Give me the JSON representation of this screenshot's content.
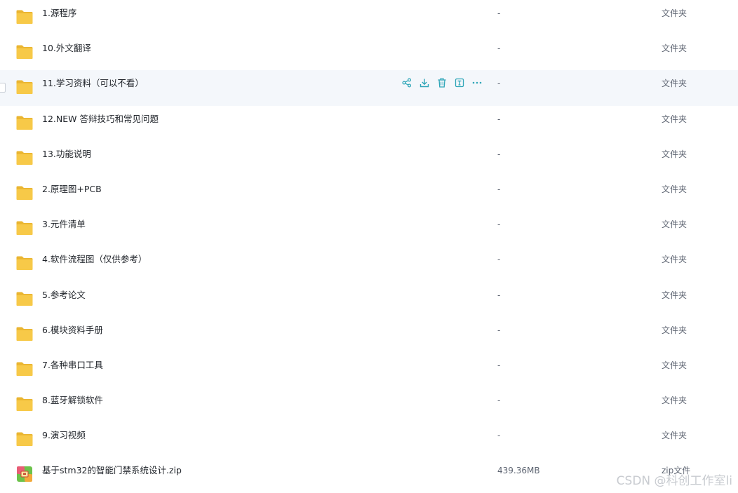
{
  "rows": [
    {
      "name": "1.源程序",
      "size": "-",
      "type": "文件夹",
      "icon": "folder-icon"
    },
    {
      "name": "10.外文翻译",
      "size": "-",
      "type": "文件夹",
      "icon": "folder-icon"
    },
    {
      "name": "11.学习资料（可以不看）",
      "size": "-",
      "type": "文件夹",
      "icon": "folder-icon"
    },
    {
      "name": "12.NEW 答辩技巧和常见问题",
      "size": "-",
      "type": "文件夹",
      "icon": "folder-icon"
    },
    {
      "name": "13.功能说明",
      "size": "-",
      "type": "文件夹",
      "icon": "folder-icon"
    },
    {
      "name": "2.原理图+PCB",
      "size": "-",
      "type": "文件夹",
      "icon": "folder-icon"
    },
    {
      "name": "3.元件清单",
      "size": "-",
      "type": "文件夹",
      "icon": "folder-icon"
    },
    {
      "name": "4.软件流程图（仅供参考）",
      "size": "-",
      "type": "文件夹",
      "icon": "folder-icon"
    },
    {
      "name": "5.参考论文",
      "size": "-",
      "type": "文件夹",
      "icon": "folder-icon"
    },
    {
      "name": "6.模块资料手册",
      "size": "-",
      "type": "文件夹",
      "icon": "folder-icon"
    },
    {
      "name": "7.各种串口工具",
      "size": "-",
      "type": "文件夹",
      "icon": "folder-icon"
    },
    {
      "name": "8.蓝牙解锁软件",
      "size": "-",
      "type": "文件夹",
      "icon": "folder-icon"
    },
    {
      "name": "9.演习视频",
      "size": "-",
      "type": "文件夹",
      "icon": "folder-icon"
    },
    {
      "name": "基于stm32的智能门禁系统设计.zip",
      "size": "439.36MB",
      "type": "zip文件",
      "icon": "zip-archive-icon"
    }
  ],
  "hover_row_actions": [
    "share-icon",
    "download-icon",
    "delete-icon",
    "rename-icon",
    "more-icon"
  ],
  "watermark": "CSDN @科创工作室li",
  "colors": {
    "folder": "#f7c948",
    "folder_dark": "#eab531",
    "action_icon": "#2fa6b8",
    "hover_bg": "#f4f7fb"
  }
}
